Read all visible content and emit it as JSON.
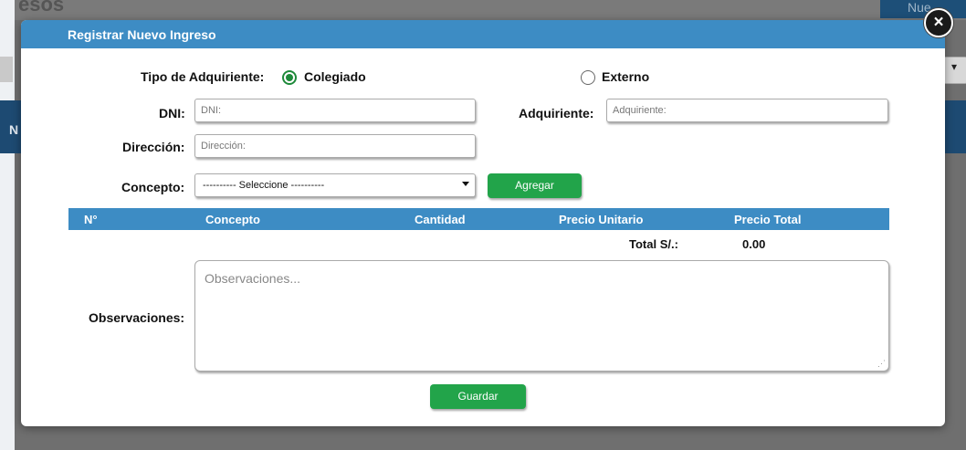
{
  "background": {
    "title_fragment": "esos",
    "button_fragment": "Nue",
    "band_letter": "N"
  },
  "modal": {
    "title": "Registrar Nuevo Ingreso",
    "close_icon": "close-icon"
  },
  "form": {
    "tipo_label": "Tipo de Adquiriente:",
    "option_colegiado": "Colegiado",
    "option_externo": "Externo",
    "selected_option": "Colegiado",
    "dni_label": "DNI:",
    "dni_placeholder": "DNI:",
    "dni_value": "",
    "adquiriente_label": "Adquiriente:",
    "adquiriente_placeholder": "Adquiriente:",
    "adquiriente_value": "",
    "direccion_label": "Dirección:",
    "direccion_placeholder": "Dirección:",
    "direccion_value": "",
    "concepto_label": "Concepto:",
    "concepto_selected": "---------- Seleccione ----------",
    "agregar_label": "Agregar"
  },
  "table": {
    "columns": [
      "N°",
      "Concepto",
      "Cantidad",
      "Precio Unitario",
      "Precio Total"
    ],
    "rows": [],
    "total_label": "Total S/.:",
    "total_value": "0.00"
  },
  "observaciones": {
    "label": "Observaciones:",
    "placeholder": "Observaciones..."
  },
  "guardar_label": "Guardar",
  "colors": {
    "header_blue": "#3d8cc4",
    "button_green": "#22a44a",
    "radio_green": "#1e8a3a"
  }
}
